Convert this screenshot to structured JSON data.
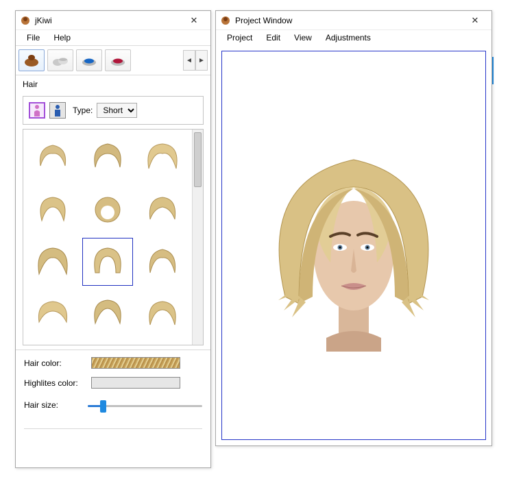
{
  "left_window": {
    "title": "jKiwi",
    "menu": {
      "file": "File",
      "help": "Help"
    },
    "section_label": "Hair",
    "gender": {
      "active": "female"
    },
    "type_label": "Type:",
    "type_value": "Short",
    "gallery_selected_index": 7,
    "hair_color_label": "Hair color:",
    "highlights_label": "Highlites color:",
    "hair_size_label": "Hair size:"
  },
  "right_window": {
    "title": "Project Window",
    "menu": {
      "project": "Project",
      "edit": "Edit",
      "view": "View",
      "adjustments": "Adjustments"
    }
  }
}
